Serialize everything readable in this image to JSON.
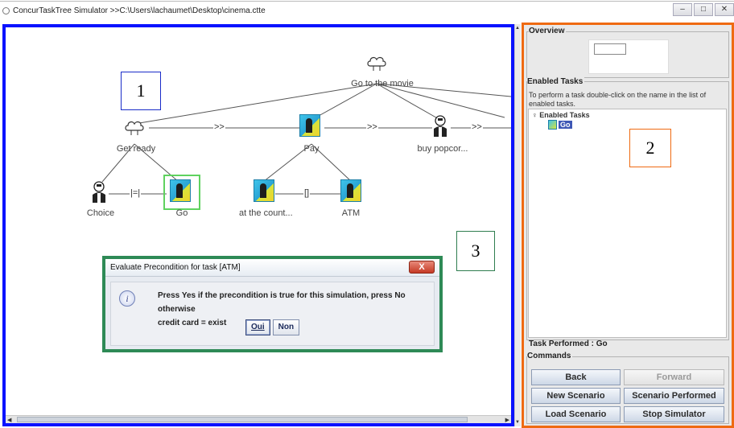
{
  "window": {
    "title": "ConcurTaskTree Simulator >>C:\\Users\\lachaumet\\Desktop\\cinema.ctte",
    "buttons": [
      "–",
      "□",
      "✕"
    ]
  },
  "callouts": {
    "one": "1",
    "two": "2",
    "three": "3"
  },
  "task_tree": {
    "root": "Go to the movie",
    "level1": [
      "Get ready",
      "Pay",
      "buy popcor..."
    ],
    "level2": [
      "Choice",
      "Go",
      "at the count...",
      "ATM"
    ],
    "operators": {
      "root_1": ">>",
      "root_2": ">>",
      "root_3": ">>",
      "choice_go": "|=|",
      "count_atm": "[]"
    }
  },
  "dialog": {
    "title": "Evaluate Precondition for task [ATM]",
    "close_label": "X",
    "info_icon": "i",
    "message_line1": "Press Yes if the precondition is true for this simulation, press No otherwise",
    "message_line2": "credit card = exist",
    "yes_label": "Oui",
    "no_label": "Non"
  },
  "panel": {
    "overview_title": "Overview",
    "enabled_title": "Enabled Tasks",
    "enabled_desc": "To perform a task double-click on the name in the list of enabled tasks.",
    "tree_root": "Enabled Tasks",
    "tree_items": [
      "Go"
    ],
    "task_performed": "Task Performed : Go",
    "commands_title": "Commands",
    "commands": {
      "back": "Back",
      "forward": "Forward",
      "new_scenario": "New Scenario",
      "scenario_performed": "Scenario Performed",
      "load_scenario": "Load Scenario",
      "stop_simulator": "Stop Simulator"
    }
  },
  "colors": {
    "canvas_border": "#0a12ff",
    "panel_border": "#ef6a12",
    "dialog_border": "#2e8a56",
    "highlight": "#5fd25f"
  }
}
